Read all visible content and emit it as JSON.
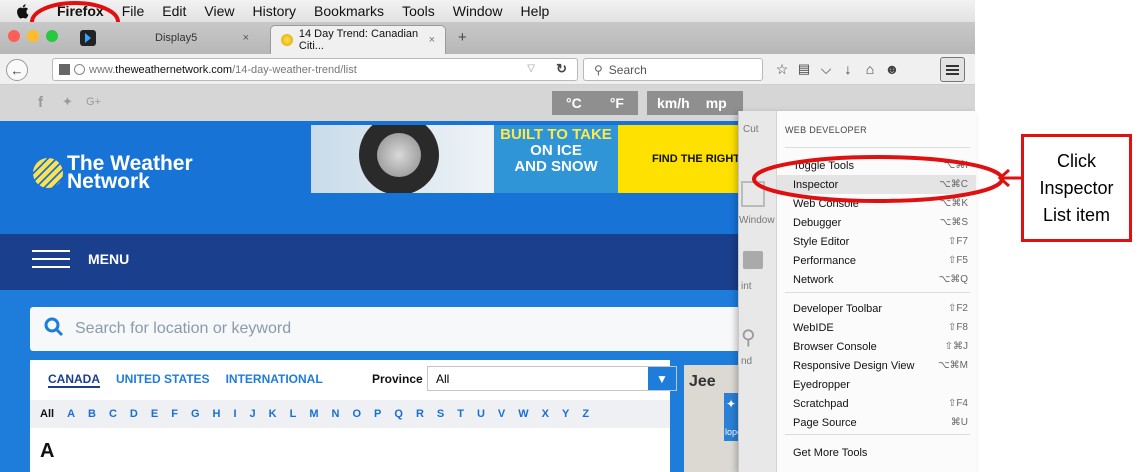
{
  "menubar": {
    "items": [
      "Firefox",
      "File",
      "Edit",
      "View",
      "History",
      "Bookmarks",
      "Tools",
      "Window",
      "Help"
    ]
  },
  "tabs": [
    {
      "title": "Display5",
      "close": "×"
    },
    {
      "title": "14 Day Trend: Canadian Citi...",
      "close": "×"
    }
  ],
  "new_tab_label": "+",
  "nav": {
    "url_prefix": "www.",
    "url_domain": "theweathernetwork.com",
    "url_path": "/14-day-weather-trend/list",
    "search_placeholder": "Search"
  },
  "page": {
    "logo_line1": "The Weather",
    "logo_line2": "Network",
    "ad_line1": "BUILT TO TAKE",
    "ad_line2": "ON ICE",
    "ad_line3": "AND SNOW",
    "ad_cta": "FIND THE RIGHT T",
    "units": [
      "°C",
      "°F",
      "km/h",
      "mp"
    ],
    "menu_label": "MENU",
    "search_placeholder": "Search for location or keyword",
    "region_tabs": [
      "CANADA",
      "UNITED STATES",
      "INTERNATIONAL"
    ],
    "province_label": "Province",
    "province_value": "All",
    "alphabet": [
      "All",
      "A",
      "B",
      "C",
      "D",
      "E",
      "F",
      "G",
      "H",
      "I",
      "J",
      "K",
      "L",
      "M",
      "N",
      "O",
      "P",
      "Q",
      "R",
      "S",
      "T",
      "U",
      "V",
      "W",
      "X",
      "Y",
      "Z"
    ],
    "section_letter": "A",
    "side_ad": "Jee",
    "developer_tab": "loper"
  },
  "dropdown": {
    "icon_labels": [
      "Cut",
      "Window",
      "int",
      "nd"
    ],
    "header": "WEB DEVELOPER",
    "items": [
      {
        "label": "Toggle Tools",
        "shortcut": "⌥⌘I"
      },
      {
        "label": "Inspector",
        "shortcut": "⌥⌘C"
      },
      {
        "label": "Web Console",
        "shortcut": "⌥⌘K"
      },
      {
        "label": "Debugger",
        "shortcut": "⌥⌘S"
      },
      {
        "label": "Style Editor",
        "shortcut": "⇧F7"
      },
      {
        "label": "Performance",
        "shortcut": "⇧F5"
      },
      {
        "label": "Network",
        "shortcut": "⌥⌘Q"
      },
      {
        "label": "Developer Toolbar",
        "shortcut": "⇧F2"
      },
      {
        "label": "WebIDE",
        "shortcut": "⇧F8"
      },
      {
        "label": "Browser Console",
        "shortcut": "⇧⌘J"
      },
      {
        "label": "Responsive Design View",
        "shortcut": "⌥⌘M"
      },
      {
        "label": "Eyedropper",
        "shortcut": ""
      },
      {
        "label": "Scratchpad",
        "shortcut": "⇧F4"
      },
      {
        "label": "Page Source",
        "shortcut": "⌘U"
      },
      {
        "label": "Get More Tools",
        "shortcut": ""
      }
    ]
  },
  "callout": {
    "line1": "Click",
    "line2": "Inspector",
    "line3": "List item"
  },
  "colors": {
    "annotation_red": "#e01010",
    "page_blue": "#1773d6",
    "menu_navy": "#1a3f8c"
  }
}
